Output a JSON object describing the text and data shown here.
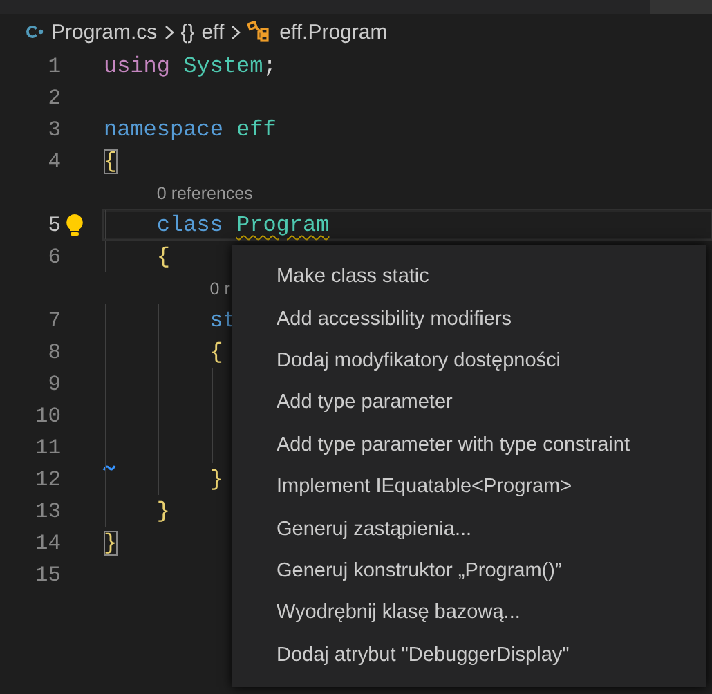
{
  "breadcrumbs": [
    {
      "kind": "file",
      "label": "Program.cs"
    },
    {
      "kind": "namespace",
      "icon_text": "{}",
      "label": "eff"
    },
    {
      "kind": "class",
      "label": "eff.Program"
    }
  ],
  "lines": [
    {
      "kind": "code",
      "number": "1",
      "current": false,
      "tokens": [
        {
          "text": "using ",
          "kind": "control"
        },
        {
          "text": "System",
          "kind": "type"
        },
        {
          "text": ";",
          "kind": "plain"
        }
      ]
    },
    {
      "kind": "code",
      "number": "2",
      "current": false
    },
    {
      "kind": "code",
      "number": "3",
      "current": false,
      "tokens": [
        {
          "text": "namespace ",
          "kind": "keyword"
        },
        {
          "text": "eff",
          "kind": "type"
        }
      ]
    },
    {
      "kind": "code",
      "number": "4",
      "current": false,
      "tokens": [
        {
          "text": "{",
          "kind": "bracket",
          "matched": true
        }
      ]
    },
    {
      "kind": "codelens",
      "text": "0 references"
    },
    {
      "kind": "code",
      "number": "5",
      "current": true,
      "lightbulb": true,
      "tokens": [
        {
          "text": "    class ",
          "kind": "keyword"
        },
        {
          "text": "Program",
          "kind": "type",
          "warning": true
        }
      ]
    },
    {
      "kind": "code",
      "number": "6",
      "current": false,
      "tokens": [
        {
          "text": "    {",
          "kind": "bracket",
          "matched": false
        }
      ]
    },
    {
      "kind": "codelens",
      "text": "0 r"
    },
    {
      "kind": "code",
      "number": "7",
      "current": false,
      "tokens": [
        {
          "text": "        st",
          "kind": "keyword"
        }
      ]
    },
    {
      "kind": "code",
      "number": "8",
      "current": false,
      "tokens": [
        {
          "text": "        {",
          "kind": "bracket",
          "matched": false
        }
      ]
    },
    {
      "kind": "code",
      "number": "9",
      "current": false
    },
    {
      "kind": "code",
      "number": "10",
      "current": false
    },
    {
      "kind": "code",
      "number": "11",
      "current": false,
      "marker": true
    },
    {
      "kind": "code",
      "number": "12",
      "current": false,
      "tokens": [
        {
          "text": "        }",
          "kind": "bracket",
          "matched": false
        }
      ]
    },
    {
      "kind": "code",
      "number": "13",
      "current": false,
      "tokens": [
        {
          "text": "    }",
          "kind": "bracket",
          "matched": false
        }
      ]
    },
    {
      "kind": "code",
      "number": "14",
      "current": false,
      "tokens": [
        {
          "text": "}",
          "kind": "bracket",
          "matched": true
        }
      ]
    },
    {
      "kind": "code",
      "number": "15",
      "current": false
    }
  ],
  "quick_fix_menu": {
    "items": [
      {
        "label": "Make class static"
      },
      {
        "label": "Add accessibility modifiers"
      },
      {
        "label": "Dodaj modyfikatory dostępności"
      },
      {
        "label": "Add type parameter"
      },
      {
        "label": "Add type parameter with type constraint"
      },
      {
        "label": "Implement IEquatable<Program>"
      },
      {
        "label": "Generuj zastąpienia..."
      },
      {
        "label": "Generuj konstruktor „Program()”"
      },
      {
        "label": "Wyodrębnij klasę bazową..."
      },
      {
        "label": "Dodaj atrybut \"DebuggerDisplay\""
      }
    ]
  }
}
